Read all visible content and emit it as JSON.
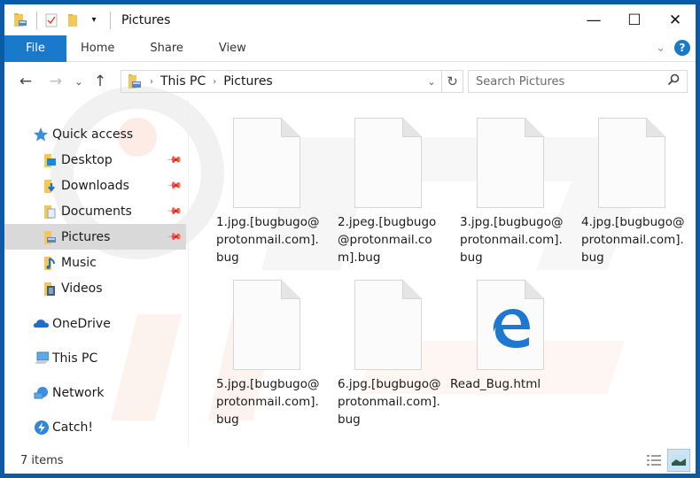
{
  "window": {
    "title": "Pictures",
    "controls": {
      "minimize": "—",
      "maximize": "☐",
      "close": "✕"
    }
  },
  "quick_access_toolbar": {
    "icons": [
      "folder-picture-icon",
      "properties-icon",
      "new-folder-icon",
      "customize-dropdown-icon"
    ]
  },
  "ribbon": {
    "tabs": [
      {
        "label": "File",
        "active": true
      },
      {
        "label": "Home"
      },
      {
        "label": "Share"
      },
      {
        "label": "View"
      }
    ],
    "expand_icon": "⌄",
    "help_label": "?"
  },
  "navigation": {
    "back": "←",
    "forward": "→",
    "recent": "⌄",
    "up": "↑",
    "breadcrumb": [
      "This PC",
      "Pictures"
    ],
    "breadcrumb_sep": "›",
    "dropdown": "⌄",
    "refresh": "↻",
    "search_placeholder": "Search Pictures",
    "search_icon": "⚲"
  },
  "sidebar": {
    "items": [
      {
        "label": "Quick access",
        "icon": "star-icon",
        "pinned": false
      },
      {
        "label": "Desktop",
        "icon": "desktop-folder-icon",
        "pinned": true
      },
      {
        "label": "Downloads",
        "icon": "downloads-folder-icon",
        "pinned": true
      },
      {
        "label": "Documents",
        "icon": "documents-folder-icon",
        "pinned": true
      },
      {
        "label": "Pictures",
        "icon": "pictures-folder-icon",
        "pinned": true,
        "selected": true
      },
      {
        "label": "Music",
        "icon": "music-folder-icon",
        "pinned": false
      },
      {
        "label": "Videos",
        "icon": "videos-folder-icon",
        "pinned": false
      },
      {
        "label": "OneDrive",
        "icon": "onedrive-icon",
        "pinned": false
      },
      {
        "label": "This PC",
        "icon": "this-pc-icon",
        "pinned": false
      },
      {
        "label": "Network",
        "icon": "network-icon",
        "pinned": false
      },
      {
        "label": "Catch!",
        "icon": "catch-icon",
        "pinned": false
      }
    ],
    "pin_glyph": "📌"
  },
  "files": [
    {
      "name": "1.jpg.[bugbugo@\nprotonmail.com].\nbug",
      "type": "blank"
    },
    {
      "name": "2.jpeg.[bugbugo\n@protonmail.co\nm].bug",
      "type": "blank"
    },
    {
      "name": "3.jpg.[bugbugo@\nprotonmail.com].\nbug",
      "type": "blank"
    },
    {
      "name": "4.jpg.[bugbugo@\nprotonmail.com].\nbug",
      "type": "blank"
    },
    {
      "name": "5.jpg.[bugbugo@\nprotonmail.com].\nbug",
      "type": "blank"
    },
    {
      "name": "6.jpg.[bugbugo@\nprotonmail.com].\nbug",
      "type": "blank"
    },
    {
      "name": "Read_Bug.html",
      "type": "edge-html"
    }
  ],
  "status": {
    "item_count": "7 items"
  },
  "colors": {
    "accent": "#1979ca",
    "frame": "#0b5aa8",
    "selected_nav": "#d9d9d9",
    "edge_blue": "#1e78d3"
  }
}
